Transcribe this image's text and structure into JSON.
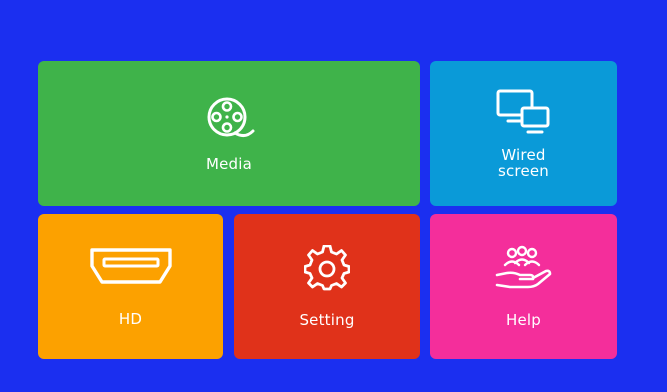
{
  "screen": {
    "background": "#1b2ff0"
  },
  "tiles": [
    {
      "id": "media",
      "label": "Media",
      "icon": "film-reel-icon",
      "color": "#3fb34a"
    },
    {
      "id": "wired",
      "label": "Wired\nscreen",
      "icon": "screen-mirror-icon",
      "color": "#0a9ad8"
    },
    {
      "id": "hd",
      "label": "HD",
      "icon": "hdmi-port-icon",
      "color": "#fca100"
    },
    {
      "id": "setting",
      "label": "Setting",
      "icon": "gear-icon",
      "color": "#e0321a"
    },
    {
      "id": "help",
      "label": "Help",
      "icon": "hand-people-icon",
      "color": "#f42e9b"
    }
  ]
}
